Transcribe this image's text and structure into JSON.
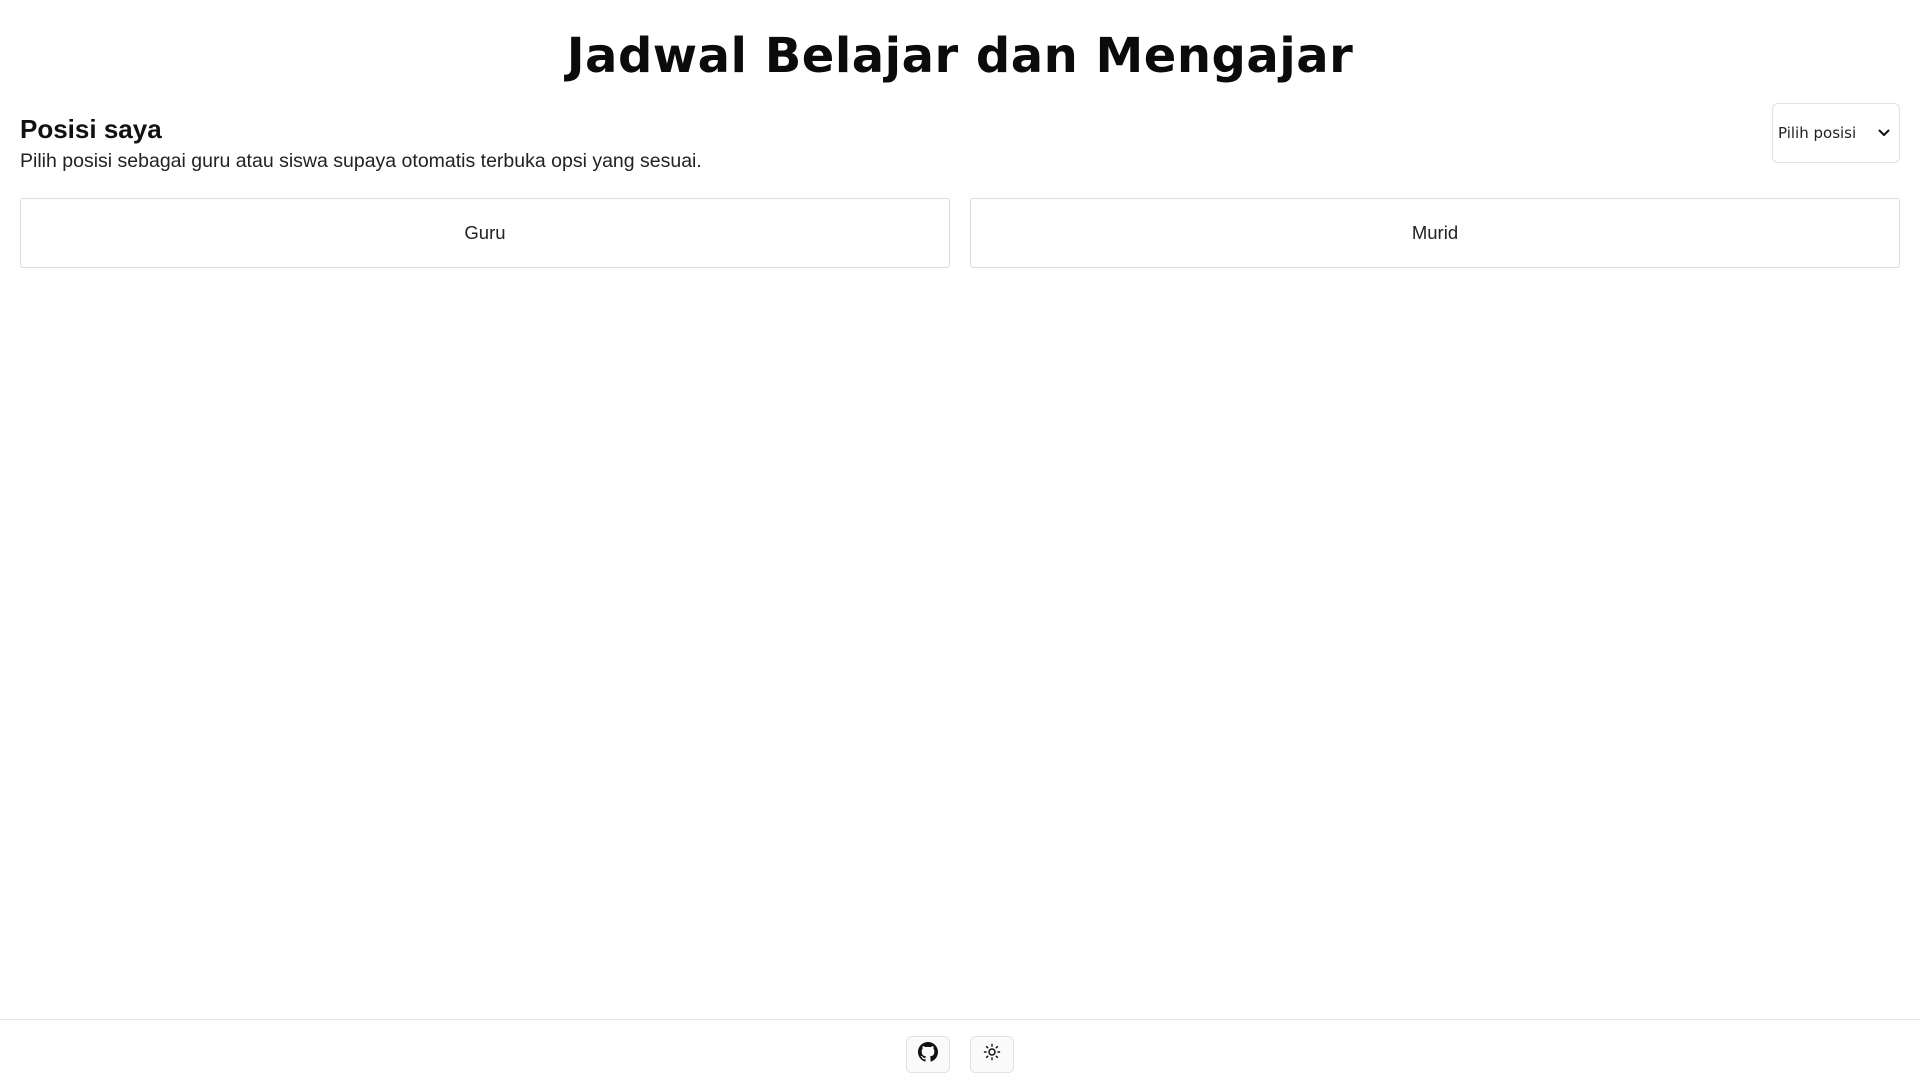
{
  "header": {
    "title": "Jadwal Belajar dan Mengajar"
  },
  "position": {
    "heading": "Posisi saya",
    "description": "Pilih posisi sebagai guru atau siswa supaya otomatis terbuka opsi yang sesuai.",
    "select": {
      "selected": "Pilih posisi"
    }
  },
  "roles": [
    {
      "label": "Guru"
    },
    {
      "label": "Murid"
    }
  ],
  "footer": {
    "icons": [
      "github-icon",
      "sun-icon"
    ]
  }
}
